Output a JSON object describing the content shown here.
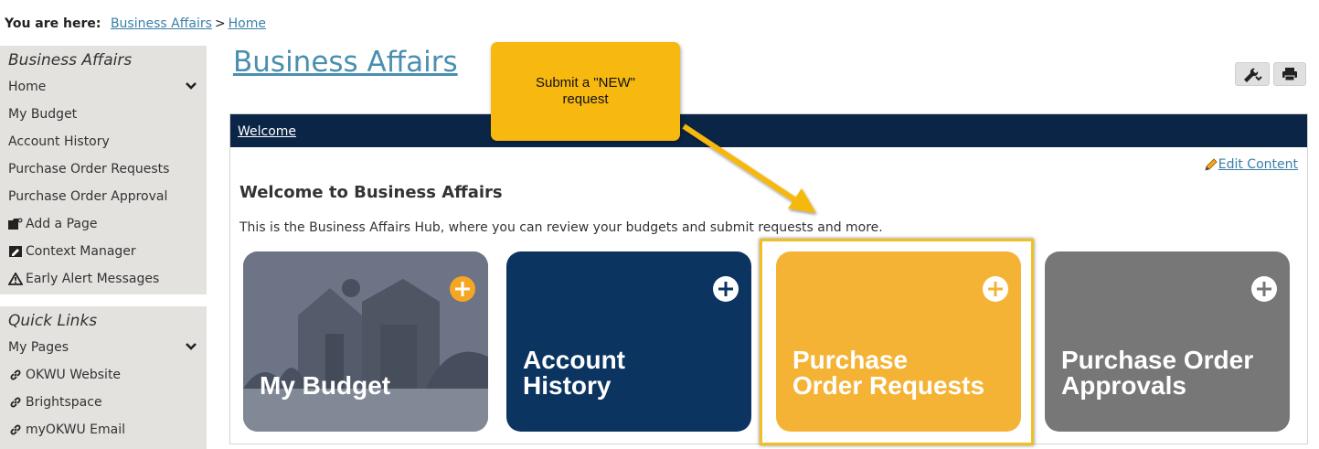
{
  "breadcrumb": {
    "label": "You are here:",
    "items": [
      "Business Affairs",
      "Home"
    ],
    "separator": ">"
  },
  "sidebar": {
    "title": "Business Affairs",
    "items": [
      {
        "label": "Home",
        "icon": "chevron-down-icon"
      },
      {
        "label": "My Budget"
      },
      {
        "label": "Account History"
      },
      {
        "label": "Purchase Order Requests"
      },
      {
        "label": "Purchase Order Approval"
      },
      {
        "label": "Add a Page",
        "icon": "add-page-icon"
      },
      {
        "label": "Context Manager",
        "icon": "context-manager-icon"
      },
      {
        "label": "Early Alert Messages",
        "icon": "warning-icon"
      }
    ]
  },
  "quick_links": {
    "title": "Quick Links",
    "items": [
      {
        "label": "My Pages",
        "icon": "chevron-down-icon"
      },
      {
        "label": "OKWU Website",
        "icon": "link-icon"
      },
      {
        "label": "Brightspace",
        "icon": "link-icon"
      },
      {
        "label": "myOKWU Email",
        "icon": "link-icon"
      }
    ]
  },
  "page": {
    "title": "Business Affairs"
  },
  "toolbar": {
    "tools_icon": "wrench-icon",
    "print_icon": "printer-icon"
  },
  "panel": {
    "header": "Welcome",
    "edit_label": "Edit Content",
    "heading": "Welcome to Business Affairs",
    "text": "This is the Business Affairs Hub, where you can review your budgets and submit requests and more."
  },
  "tiles": [
    {
      "label": "My Budget",
      "color": "#6a7382",
      "plus_color": "#f5a623"
    },
    {
      "label": "Account\nHistory",
      "color": "#0b3461",
      "plus_color": "#ffffff"
    },
    {
      "label": "Purchase\nOrder Requests",
      "color": "#f5b335",
      "plus_color": "#ffffff"
    },
    {
      "label": "Purchase Order\nApprovals",
      "color": "#777777",
      "plus_color": "#ffffff"
    }
  ],
  "callout": {
    "text": "Submit a \"NEW\"\nrequest",
    "color": "#f7b810"
  },
  "colors": {
    "link": "#3a7fa8",
    "title": "#4a8fb0",
    "panel_header": "#0b2546",
    "highlight": "#f0c020"
  }
}
